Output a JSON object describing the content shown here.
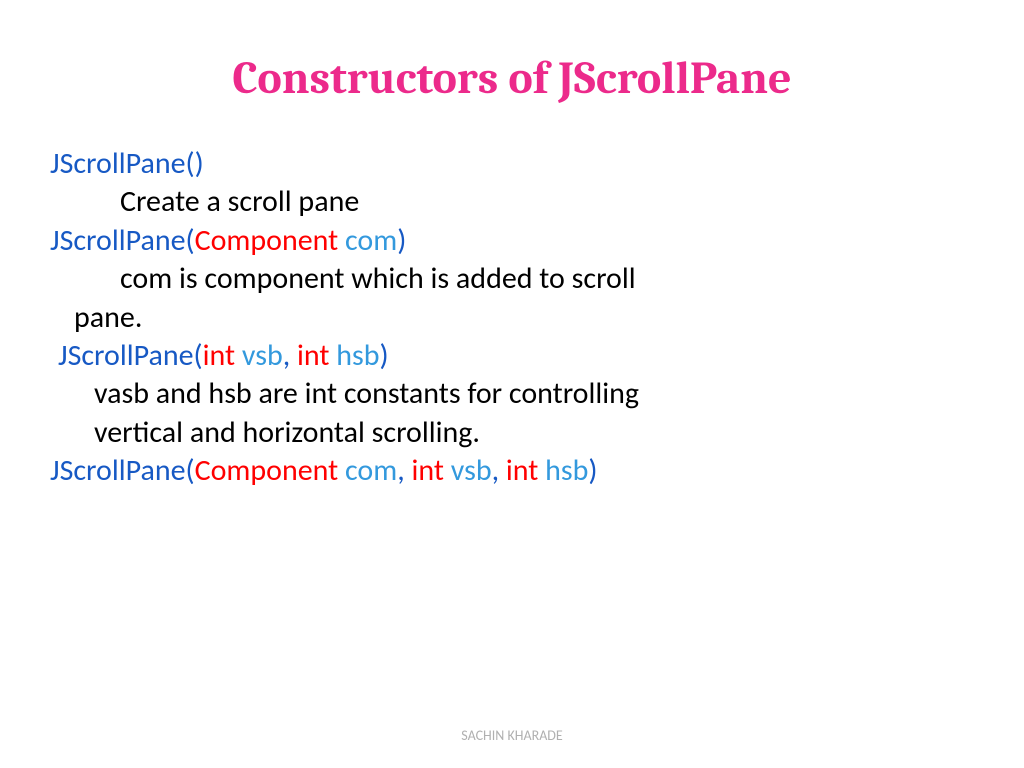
{
  "title": "Constructors of JScrollPane",
  "c1": {
    "sig": "JScrollPane()",
    "desc": "Create a scroll pane"
  },
  "c2": {
    "name": "JScrollPane(",
    "type1": "Component ",
    "param1": "com",
    "close": ")",
    "desc1": "com is component which is added to scroll",
    "desc2": "pane."
  },
  "c3": {
    "name": "JScrollPane(",
    "type1": "int ",
    "param1": "vsb",
    "comma": ", ",
    "type2": "int ",
    "param2": "hsb",
    "close": ")",
    "desc1": "vasb and hsb are int constants for controlling",
    "desc2": "vertical and horizontal scrolling."
  },
  "c4": {
    "name": "JScrollPane(",
    "type1": "Component ",
    "param1": "com",
    "comma1": ", ",
    "type2": "int ",
    "param2": "vsb",
    "comma2": ", ",
    "type3": "int ",
    "param3": "hsb",
    "close": ")"
  },
  "footer": "SACHIN KHARADE"
}
